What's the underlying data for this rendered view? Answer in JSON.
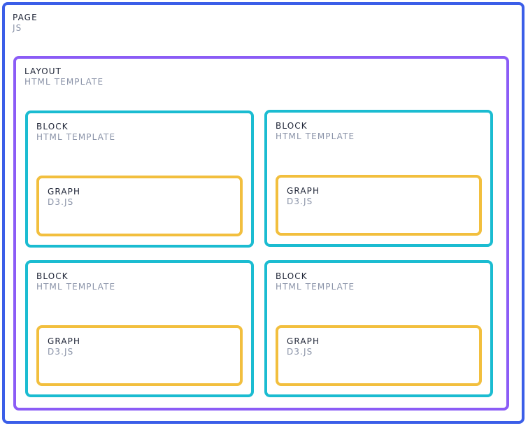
{
  "page": {
    "title": "PAGE",
    "subtitle": "JS"
  },
  "layout": {
    "title": "LAYOUT",
    "subtitle": "HTML TEMPLATE"
  },
  "blocks": [
    {
      "title": "BLOCK",
      "subtitle": "HTML TEMPLATE",
      "graph": {
        "title": "GRAPH",
        "subtitle": "D3.JS"
      }
    },
    {
      "title": "BLOCK",
      "subtitle": "HTML TEMPLATE",
      "graph": {
        "title": "GRAPH",
        "subtitle": "D3.JS"
      }
    },
    {
      "title": "BLOCK",
      "subtitle": "HTML TEMPLATE",
      "graph": {
        "title": "GRAPH",
        "subtitle": "D3.JS"
      }
    },
    {
      "title": "BLOCK",
      "subtitle": "HTML TEMPLATE",
      "graph": {
        "title": "GRAPH",
        "subtitle": "D3.JS"
      }
    }
  ],
  "colors": {
    "page": "#3b5ee8",
    "layout": "#8b5cf6",
    "block": "#1bbcd1",
    "graph": "#f2bf3e",
    "title_text": "#1f2537",
    "subtitle_text": "#8a93a8"
  }
}
